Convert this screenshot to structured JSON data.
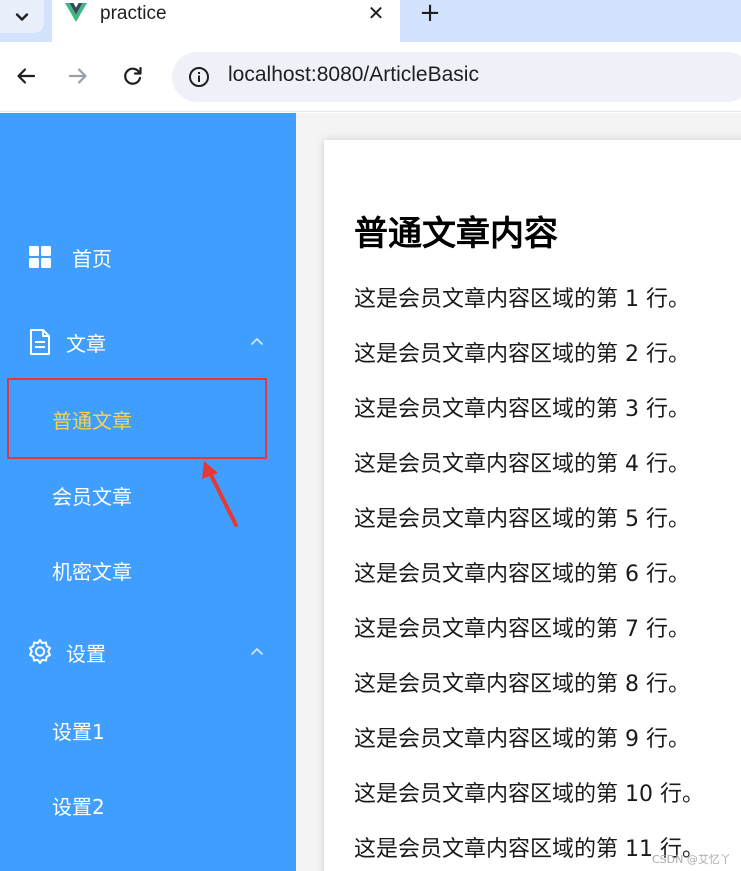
{
  "browser": {
    "tab_title": "practice",
    "close_glyph": "✕",
    "new_tab_glyph": "+",
    "url": "localhost:8080/ArticleBasic",
    "icons": [
      "tab-list-icon",
      "vue-logo-icon",
      "back-icon",
      "forward-icon",
      "reload-icon",
      "info-icon"
    ]
  },
  "sidebar": {
    "background": "#409eff",
    "active_color": "#ffd04b",
    "items": [
      {
        "label": "首页",
        "icon": "grid-icon"
      },
      {
        "label": "文章",
        "icon": "document-icon"
      },
      {
        "label": "普通文章"
      },
      {
        "label": "会员文章"
      },
      {
        "label": "机密文章"
      },
      {
        "label": "设置",
        "icon": "gear-icon"
      },
      {
        "label": "设置1"
      },
      {
        "label": "设置2"
      }
    ]
  },
  "annotation": {
    "box_color": "#e53935"
  },
  "content": {
    "title": "普通文章内容",
    "lines": [
      "这是会员文章内容区域的第 1 行。",
      "这是会员文章内容区域的第 2 行。",
      "这是会员文章内容区域的第 3 行。",
      "这是会员文章内容区域的第 4 行。",
      "这是会员文章内容区域的第 5 行。",
      "这是会员文章内容区域的第 6 行。",
      "这是会员文章内容区域的第 7 行。",
      "这是会员文章内容区域的第 8 行。",
      "这是会员文章内容区域的第 9 行。",
      "这是会员文章内容区域的第 10 行。",
      "这是会员文章内容区域的第 11 行。"
    ]
  },
  "watermark": "CSDN @艾忆丫"
}
